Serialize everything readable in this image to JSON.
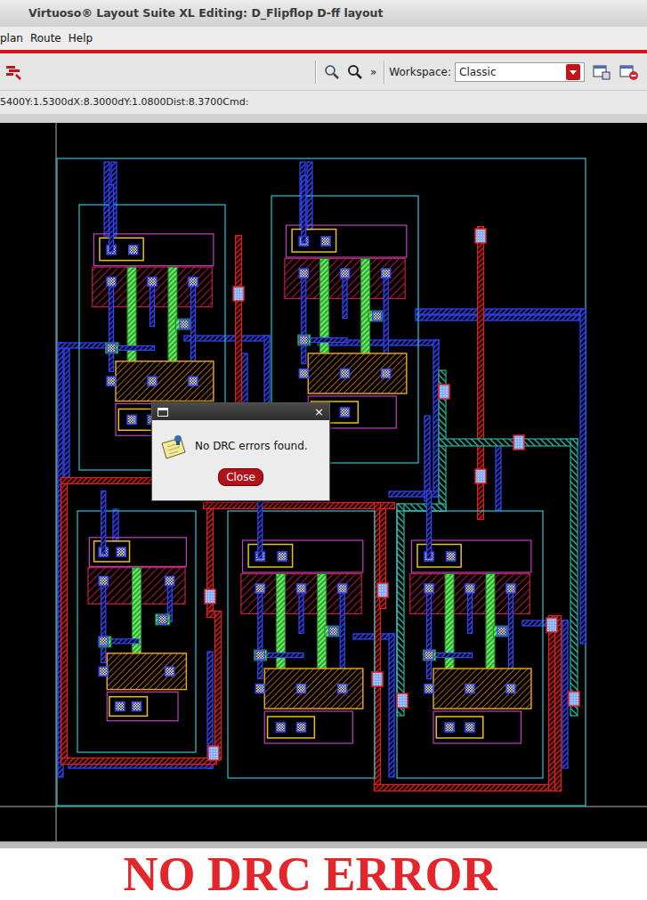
{
  "window": {
    "title": "Virtuoso® Layout Suite XL Editing: D_Flipflop D-ff layout"
  },
  "menu": [
    {
      "label": "plan"
    },
    {
      "label": "Route"
    },
    {
      "label": "Help"
    }
  ],
  "toolbar": {
    "more": "»",
    "workspace_label": "Workspace:",
    "workspace_value": "Classic"
  },
  "status_bar": {
    "coords": "5400Y:1.5300dX:8.3000dY:1.0800Dist:8.3700Cmd:"
  },
  "dialog": {
    "close_glyph": "×",
    "message": "No DRC errors found.",
    "button": "Close"
  },
  "caption": "NO DRC ERROR"
}
